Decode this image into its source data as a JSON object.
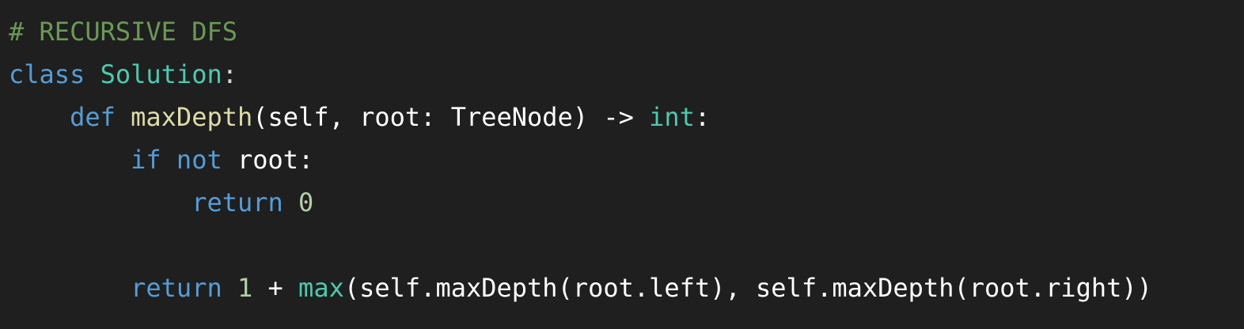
{
  "code": {
    "lines": [
      [
        {
          "text": "# RECURSIVE DFS",
          "kind": "comment"
        }
      ],
      [
        {
          "text": "class",
          "kind": "keyword"
        },
        {
          "text": " ",
          "kind": "plain"
        },
        {
          "text": "Solution",
          "kind": "type"
        },
        {
          "text": ":",
          "kind": "plain"
        }
      ],
      [
        {
          "text": "    ",
          "kind": "plain"
        },
        {
          "text": "def",
          "kind": "keyword"
        },
        {
          "text": " ",
          "kind": "plain"
        },
        {
          "text": "maxDepth",
          "kind": "func"
        },
        {
          "text": "(self, root: TreeNode) -> ",
          "kind": "ident"
        },
        {
          "text": "int",
          "kind": "type"
        },
        {
          "text": ":",
          "kind": "ident"
        }
      ],
      [
        {
          "text": "        ",
          "kind": "plain"
        },
        {
          "text": "if",
          "kind": "keyword"
        },
        {
          "text": " ",
          "kind": "plain"
        },
        {
          "text": "not",
          "kind": "keyword"
        },
        {
          "text": " root:",
          "kind": "ident"
        }
      ],
      [
        {
          "text": "            ",
          "kind": "plain"
        },
        {
          "text": "return",
          "kind": "keyword"
        },
        {
          "text": " ",
          "kind": "plain"
        },
        {
          "text": "0",
          "kind": "number"
        }
      ],
      [],
      [
        {
          "text": "        ",
          "kind": "plain"
        },
        {
          "text": "return",
          "kind": "keyword"
        },
        {
          "text": " ",
          "kind": "plain"
        },
        {
          "text": "1",
          "kind": "number"
        },
        {
          "text": " + ",
          "kind": "ident"
        },
        {
          "text": "max",
          "kind": "builtin"
        },
        {
          "text": "(self.maxDepth(root.left), self.maxDepth(root.right))",
          "kind": "ident"
        }
      ]
    ]
  },
  "colors": {
    "background": "#1f1f1f",
    "comment": "#6a9955",
    "keyword": "#569cd6",
    "type": "#4ec9b0",
    "function": "#dcdcaa",
    "number": "#b5cea8",
    "identifier": "#ffffff"
  }
}
